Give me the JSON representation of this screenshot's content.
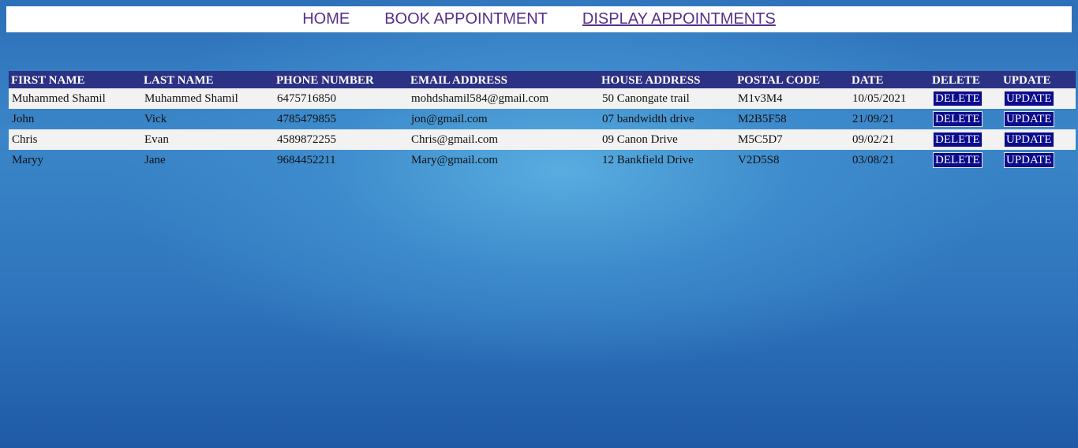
{
  "nav": {
    "home": "HOME",
    "book": "BOOK APPOINTMENT",
    "display": "DISPLAY APPOINTMENTS"
  },
  "table": {
    "headers": {
      "first_name": "FIRST NAME",
      "last_name": "LAST NAME",
      "phone": "PHONE NUMBER",
      "email": "EMAIL ADDRESS",
      "house": "HOUSE ADDRESS",
      "postal": "POSTAL CODE",
      "date": "DATE",
      "delete": "DELETE",
      "update": "UPDATE"
    },
    "delete_label": "DELETE",
    "update_label": "UPDATE",
    "rows": [
      {
        "first_name": "Muhammed Shamil",
        "last_name": "Muhammed Shamil",
        "phone": "6475716850",
        "email": "mohdshamil584@gmail.com",
        "house": "50 Canongate trail",
        "postal": "M1v3M4",
        "date": "10/05/2021"
      },
      {
        "first_name": "John",
        "last_name": "Vick",
        "phone": "4785479855",
        "email": "jon@gmail.com",
        "house": "07 bandwidth drive",
        "postal": "M2B5F58",
        "date": "21/09/21"
      },
      {
        "first_name": "Chris",
        "last_name": "Evan",
        "phone": "4589872255",
        "email": "Chris@gmail.com",
        "house": "09 Canon Drive",
        "postal": "M5C5D7",
        "date": "09/02/21"
      },
      {
        "first_name": "Maryy",
        "last_name": "Jane",
        "phone": "9684452211",
        "email": "Mary@gmail.com",
        "house": "12 Bankfield Drive",
        "postal": "V2D5S8",
        "date": "03/08/21"
      }
    ]
  },
  "colors": {
    "nav_link": "#55308a",
    "header_bg": "#2b3183",
    "button_bg": "#0b0b8c",
    "row_light": "#f2f2f2"
  }
}
